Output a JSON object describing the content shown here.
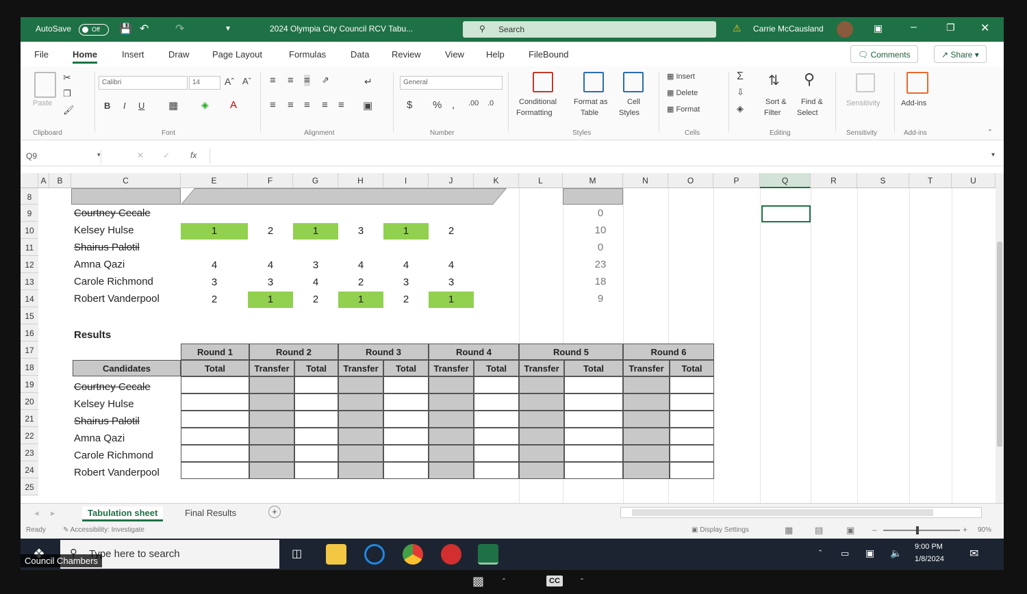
{
  "titlebar": {
    "autosave": "AutoSave",
    "autosave_state": "Off",
    "document_title": "2024 Olympia City Council RCV Tabu...",
    "search_placeholder": "Search",
    "user": "Carrie McCausland"
  },
  "menu": [
    "File",
    "Home",
    "Insert",
    "Draw",
    "Page Layout",
    "Formulas",
    "Data",
    "Review",
    "View",
    "Help",
    "FileBound"
  ],
  "menu_active": "Home",
  "comments_label": "Comments",
  "share_label": "Share",
  "ribbon": {
    "paste": "Paste",
    "clipboard": "Clipboard",
    "font_name": "Calibri",
    "font_size": "14",
    "font": "Font",
    "alignment": "Alignment",
    "number_format": "General",
    "number": "Number",
    "conditional_formatting_1": "Conditional",
    "conditional_formatting_2": "Formatting",
    "format_table_1": "Format as",
    "format_table_2": "Table",
    "cell_styles_1": "Cell",
    "cell_styles_2": "Styles",
    "styles": "Styles",
    "insert": "Insert",
    "delete": "Delete",
    "format": "Format",
    "cells": "Cells",
    "sort_filter_1": "Sort &",
    "sort_filter_2": "Filter",
    "find_select_1": "Find &",
    "find_select_2": "Select",
    "editing": "Editing",
    "sensitivity": "Sensitivity",
    "sensitivity_group": "Sensitivity",
    "addins": "Add-ins",
    "addins_group": "Add-ins"
  },
  "formula_bar": {
    "name_box": "Q9",
    "fx": "fx"
  },
  "columns": [
    "A",
    "B",
    "C",
    "E",
    "F",
    "G",
    "H",
    "I",
    "J",
    "K",
    "L",
    "M",
    "N",
    "O",
    "P",
    "Q",
    "R",
    "S",
    "T",
    "U"
  ],
  "selected_column": "Q",
  "rows": [
    "8",
    "9",
    "10",
    "11",
    "12",
    "13",
    "14",
    "15",
    "16",
    "17",
    "18",
    "19",
    "20",
    "21",
    "22",
    "23",
    "24",
    "25"
  ],
  "candidates": [
    {
      "name": "Courtney Cecale",
      "struck": true,
      "ranks": [
        "",
        "",
        "",
        "",
        "",
        ""
      ],
      "total": "0"
    },
    {
      "name": "Kelsey Hulse",
      "struck": false,
      "ranks": [
        "1",
        "2",
        "1",
        "3",
        "1",
        "2"
      ],
      "total": "10"
    },
    {
      "name": "Shairus Palotil",
      "struck": true,
      "ranks": [
        "",
        "",
        "",
        "",
        "",
        ""
      ],
      "total": "0"
    },
    {
      "name": "Amna Qazi",
      "struck": false,
      "ranks": [
        "4",
        "4",
        "3",
        "4",
        "4",
        "4"
      ],
      "total": "23"
    },
    {
      "name": "Carole Richmond",
      "struck": false,
      "ranks": [
        "3",
        "3",
        "4",
        "2",
        "3",
        "3"
      ],
      "total": "18"
    },
    {
      "name": "Robert Vanderpool",
      "struck": false,
      "ranks": [
        "2",
        "1",
        "2",
        "1",
        "2",
        "1"
      ],
      "total": "9"
    }
  ],
  "results": {
    "label": "Results",
    "candidates_header": "Candidates",
    "rounds": [
      "Round 1",
      "Round 2",
      "Round 3",
      "Round 4",
      "Round 5",
      "Round 6"
    ],
    "total_label": "Total",
    "transfer_label": "Transfer"
  },
  "sheet_tabs": [
    "Tabulation sheet",
    "Final Results"
  ],
  "status": {
    "ready": "Ready",
    "accessibility": "Accessibility: Investigate",
    "display_settings": "Display Settings",
    "zoom": "90%"
  },
  "taskbar": {
    "search_placeholder": "Type here to search",
    "time": "9:00 PM",
    "date": "1/8/2024"
  },
  "caption": "Council Chambers",
  "colors": {
    "excel_green": "#1e7145",
    "highlight": "#92d050"
  }
}
